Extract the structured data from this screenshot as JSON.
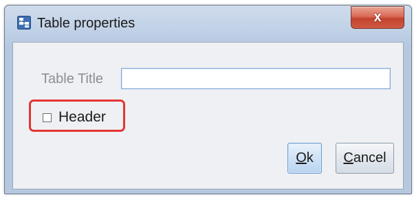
{
  "window": {
    "title": "Table properties",
    "icon": "table-properties-icon",
    "close_label": "x"
  },
  "form": {
    "title_label": "Table Title",
    "title_value": "",
    "title_placeholder": "",
    "header_label": "Header",
    "header_checked": false
  },
  "buttons": {
    "ok_mnemonic": "O",
    "ok_rest": "k",
    "cancel_mnemonic": "C",
    "cancel_rest": "ancel"
  },
  "colors": {
    "highlight": "#e53333",
    "close_button": "#c2432f",
    "input_border": "#7ea9d8"
  }
}
